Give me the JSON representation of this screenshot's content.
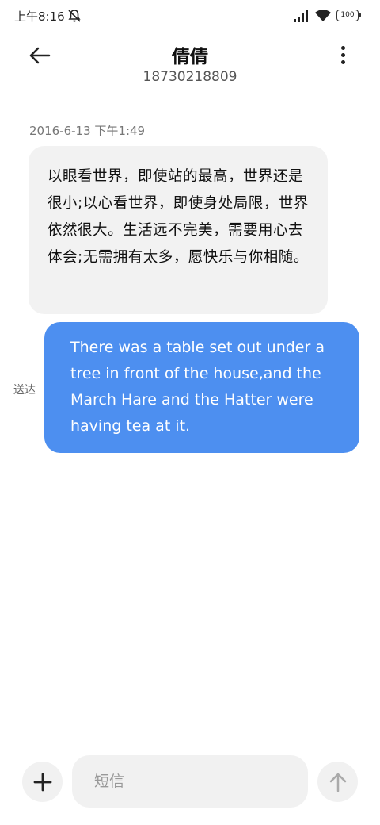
{
  "status_bar": {
    "time": "上午8:16",
    "battery": "100"
  },
  "header": {
    "contact_name": "倩倩",
    "contact_number": "18730218809"
  },
  "conversation": {
    "timestamp": "2016-6-13 下午1:49",
    "incoming_message": "以眼看世界，即使站的最高，世界还是很小;以心看世界，即使身处局限，世界依然很大。生活远不完美，需要用心去体会;无需拥有太多，愿快乐与你相随。",
    "outgoing_message": "There was a table set out under a tree in front of the house,and the March Hare and the Hatter were having tea at it.",
    "delivery_status": "送达"
  },
  "compose": {
    "placeholder": "短信"
  },
  "icons": {
    "back": "back-arrow-icon",
    "more": "more-vert-icon",
    "add": "plus-icon",
    "send": "arrow-up-icon"
  },
  "colors": {
    "outgoing_bubble": "#4d8ff0",
    "incoming_bubble": "#f2f2f2"
  }
}
